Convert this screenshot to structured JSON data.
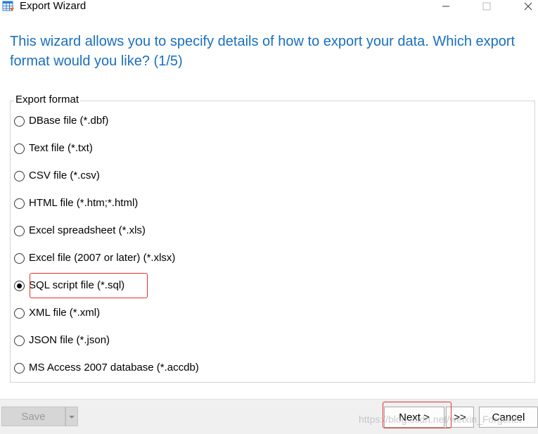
{
  "window": {
    "title": "Export Wizard",
    "icon": "table-grid-icon",
    "controls": [
      "minimize-icon",
      "maximize-icon",
      "close-icon"
    ]
  },
  "heading": "This wizard allows you to specify details of how to export your data. Which export format would you like? (1/5)",
  "export_format": {
    "legend": "Export format",
    "selected": "SQL script file (*.sql)",
    "options": [
      {
        "label": "DBase file (*.dbf)",
        "checked": false
      },
      {
        "label": "Text file (*.txt)",
        "checked": false
      },
      {
        "label": "CSV file (*.csv)",
        "checked": false
      },
      {
        "label": "HTML file (*.htm;*.html)",
        "checked": false
      },
      {
        "label": "Excel spreadsheet (*.xls)",
        "checked": false
      },
      {
        "label": "Excel file (2007 or later) (*.xlsx)",
        "checked": false
      },
      {
        "label": "SQL script file (*.sql)",
        "checked": true
      },
      {
        "label": "XML file (*.xml)",
        "checked": false
      },
      {
        "label": "JSON file (*.json)",
        "checked": false
      },
      {
        "label": "MS Access 2007 database (*.accdb)",
        "checked": false
      }
    ]
  },
  "buttons": {
    "save": "Save",
    "next": "Next >",
    "skip": ">>",
    "cancel": "Cancel"
  },
  "watermark": "https://blog.csdn.net/weixin_Forgenet",
  "colors": {
    "heading": "#1a6fbd",
    "annotation": "#e0302e",
    "bottom_bar": "#f0f0f0"
  }
}
